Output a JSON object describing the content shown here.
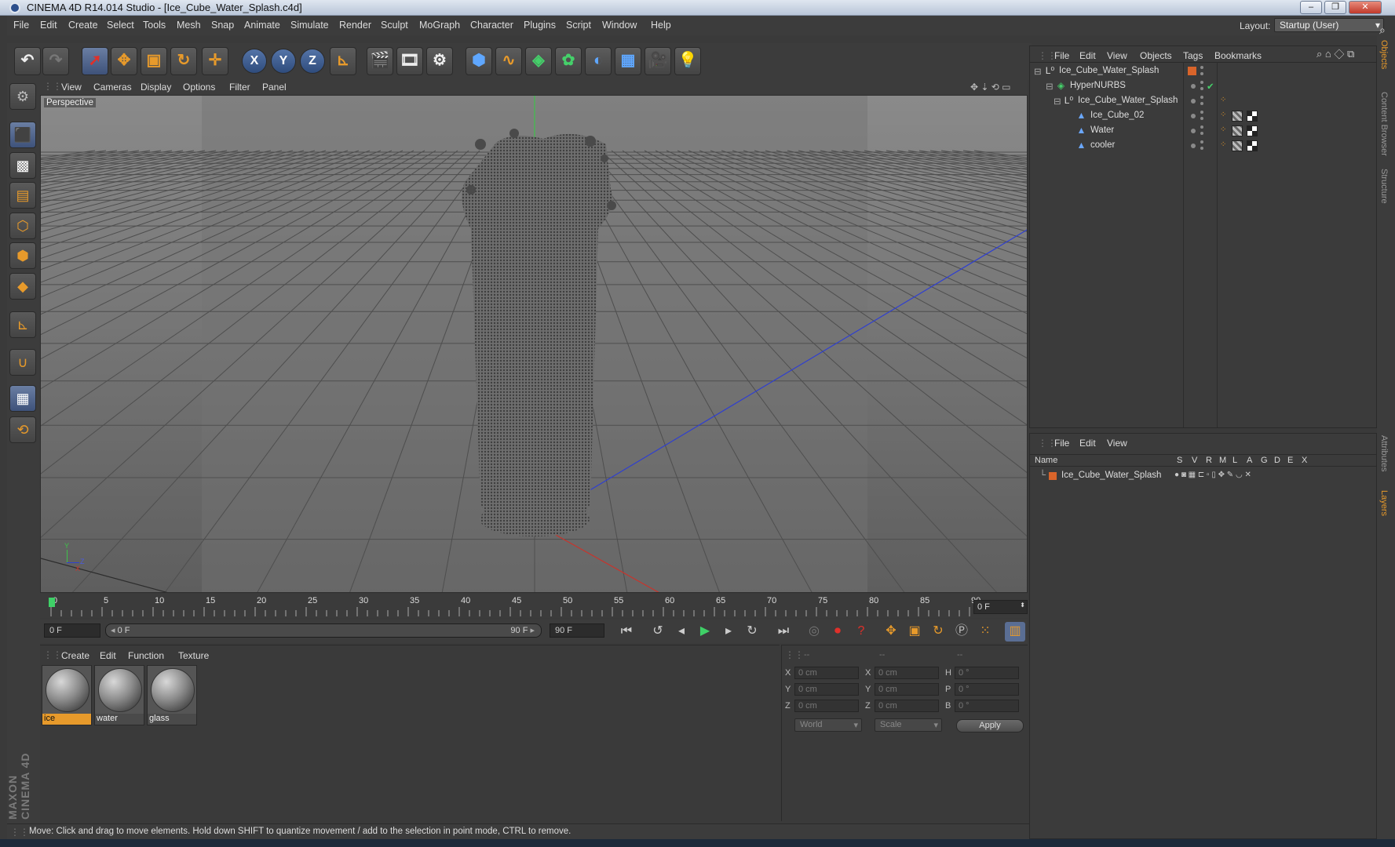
{
  "window": {
    "title": "CINEMA 4D R14.014 Studio - [Ice_Cube_Water_Splash.c4d]"
  },
  "menubar": {
    "items": [
      "File",
      "Edit",
      "Create",
      "Select",
      "Tools",
      "Mesh",
      "Snap",
      "Animate",
      "Simulate",
      "Render",
      "Sculpt",
      "MoGraph",
      "Character",
      "Plugins",
      "Script",
      "Window",
      "Help"
    ],
    "layout_label": "Layout:",
    "layout_value": "Startup (User)"
  },
  "viewport": {
    "menu": [
      "View",
      "Cameras",
      "Display",
      "Options",
      "Filter",
      "Panel"
    ],
    "label": "Perspective",
    "axis_y": "Y",
    "axis_z": "Z",
    "axis_x": "X"
  },
  "timeline": {
    "ticks": [
      "0",
      "5",
      "10",
      "15",
      "20",
      "25",
      "30",
      "35",
      "40",
      "45",
      "50",
      "55",
      "60",
      "65",
      "70",
      "75",
      "80",
      "85",
      "90"
    ],
    "current_frame": "0 F",
    "start_field": "0 F",
    "range_start": "0 F",
    "range_end": "90 F",
    "end_field": "90 F",
    "playhead_frame": 0
  },
  "material_manager": {
    "menu": [
      "Create",
      "Edit",
      "Function",
      "Texture"
    ],
    "materials": [
      "ice",
      "water",
      "glass"
    ]
  },
  "coord_manager": {
    "headers": [
      "--",
      "--",
      "--"
    ],
    "rows": [
      {
        "axis": "X",
        "pos": "0 cm",
        "size_axis": "X",
        "size": "0 cm",
        "rot_axis": "H",
        "rot": "0 °"
      },
      {
        "axis": "Y",
        "pos": "0 cm",
        "size_axis": "Y",
        "size": "0 cm",
        "rot_axis": "P",
        "rot": "0 °"
      },
      {
        "axis": "Z",
        "pos": "0 cm",
        "size_axis": "Z",
        "size": "0 cm",
        "rot_axis": "B",
        "rot": "0 °"
      }
    ],
    "mode": "World",
    "type": "Scale",
    "apply": "Apply"
  },
  "status": "Move: Click and drag to move elements. Hold down SHIFT to quantize movement / add to the selection in point mode, CTRL to remove.",
  "object_manager": {
    "menu": [
      "File",
      "Edit",
      "View",
      "Objects",
      "Tags",
      "Bookmarks"
    ],
    "objects": [
      {
        "name": "Ice_Cube_Water_Splash"
      },
      {
        "name": "HyperNURBS"
      },
      {
        "name": "Ice_Cube_Water_Splash"
      },
      {
        "name": "Ice_Cube_02"
      },
      {
        "name": "Water"
      },
      {
        "name": "cooler"
      }
    ]
  },
  "layer_manager": {
    "menu": [
      "File",
      "Edit",
      "View"
    ],
    "columns": [
      "Name",
      "S",
      "V",
      "R",
      "M",
      "L",
      "A",
      "G",
      "D",
      "E",
      "X"
    ],
    "layers": [
      {
        "name": "Ice_Cube_Water_Splash",
        "color": "#d9642a"
      }
    ]
  },
  "side_tabs": [
    "Objects",
    "Content Browser",
    "Structure",
    "Attributes",
    "Layers"
  ],
  "brand": "MAXON CINEMA 4D",
  "colors": {
    "accent": "#e79a2b",
    "selection": "#6a7ea3",
    "x_axis": "#c8342c",
    "y_axis": "#3ec14a",
    "z_axis": "#2f3fd0"
  }
}
